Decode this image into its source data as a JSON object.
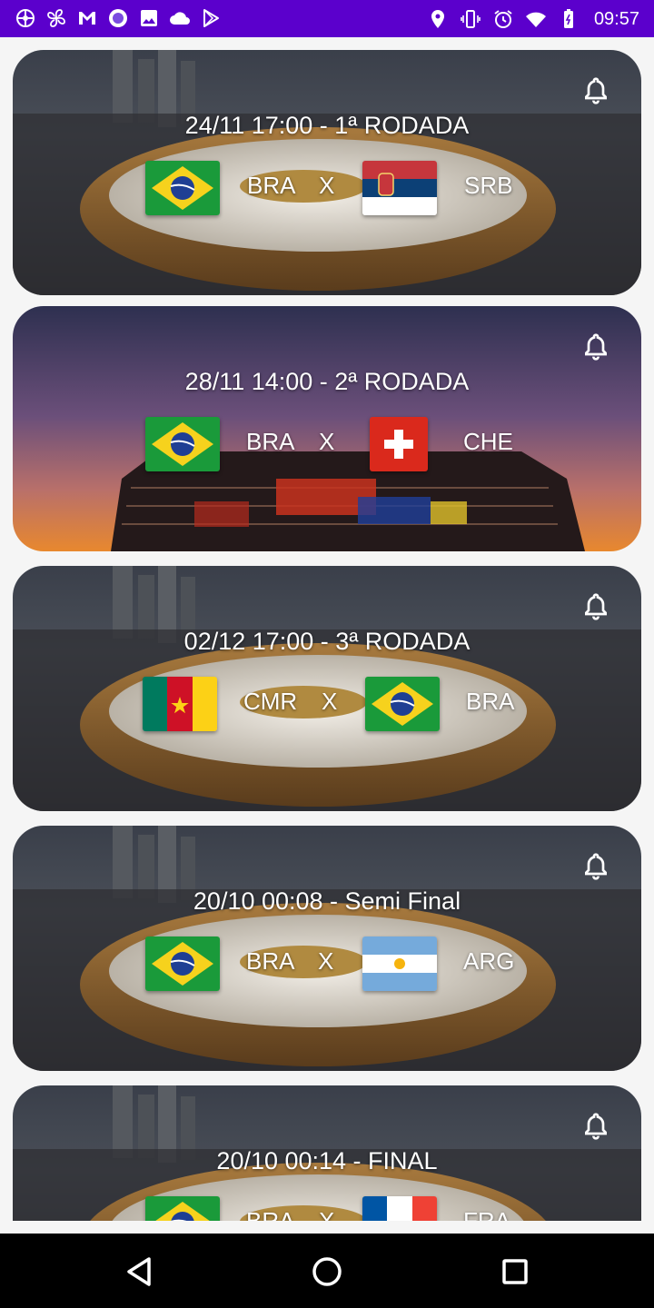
{
  "status_bar": {
    "time": "09:57",
    "left_icons": [
      "settings-wheel-icon",
      "fan-icon",
      "gmail-icon",
      "circle-app-icon",
      "gallery-icon",
      "cloud-icon",
      "play-store-icon"
    ],
    "right_icons": [
      "location-icon",
      "vibrate-icon",
      "alarm-icon",
      "wifi-icon",
      "battery-icon"
    ]
  },
  "matches": [
    {
      "title": "24/11 17:00 - 1ª RODADA",
      "home_code": "BRA",
      "vs": "X",
      "away_code": "SRB",
      "home_flag": "brazil-flag",
      "away_flag": "serbia-flag",
      "background": "lusail-stadium-night"
    },
    {
      "title": "28/11 14:00 - 2ª RODADA",
      "home_code": "BRA",
      "vs": "X",
      "away_code": "CHE",
      "home_flag": "brazil-flag",
      "away_flag": "switzerland-flag",
      "background": "stadium-974-sunset"
    },
    {
      "title": "02/12 17:00 - 3ª RODADA",
      "home_code": "CMR",
      "vs": "X",
      "away_code": "BRA",
      "home_flag": "cameroon-flag",
      "away_flag": "brazil-flag",
      "background": "lusail-stadium-night"
    },
    {
      "title": "20/10 00:08 - Semi Final",
      "home_code": "BRA",
      "vs": "X",
      "away_code": "ARG",
      "home_flag": "brazil-flag",
      "away_flag": "argentina-flag",
      "background": "lusail-stadium-night"
    },
    {
      "title": "20/10 00:14 - FINAL",
      "home_code": "BRA",
      "vs": "X",
      "away_code": "FRA",
      "home_flag": "brazil-flag",
      "away_flag": "france-flag",
      "background": "lusail-stadium-night"
    }
  ],
  "nav_bar": {
    "buttons": [
      "back-icon",
      "home-icon",
      "recents-icon"
    ]
  },
  "colors": {
    "status_bar": "#5b00cc",
    "card_text": "#ffffff",
    "nav_bar": "#000000"
  }
}
